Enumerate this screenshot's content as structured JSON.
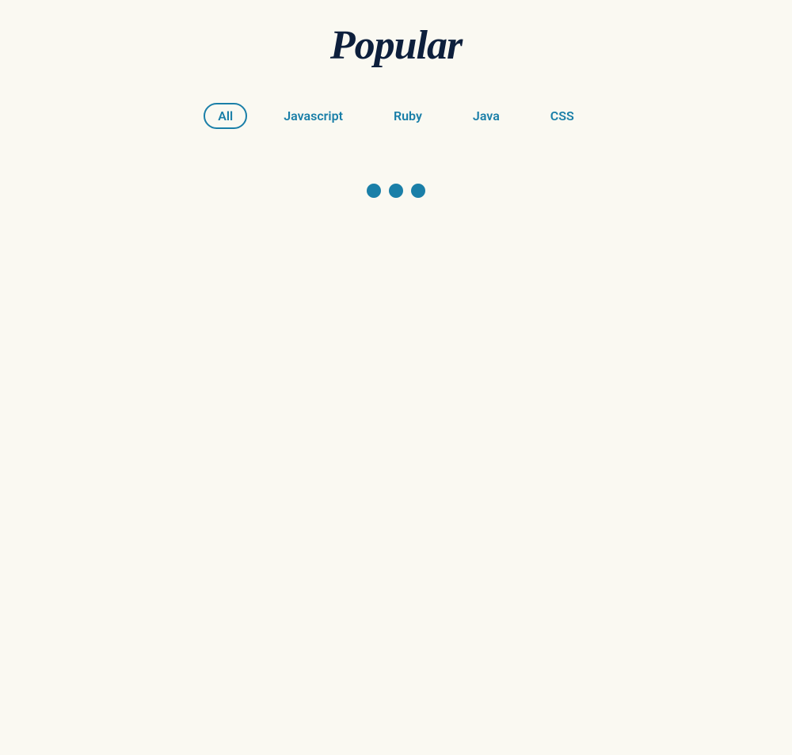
{
  "page": {
    "title": "Popular",
    "background_color": "#faf9f2"
  },
  "filters": {
    "items": [
      {
        "label": "All",
        "active": true
      },
      {
        "label": "Javascript",
        "active": false
      },
      {
        "label": "Ruby",
        "active": false
      },
      {
        "label": "Java",
        "active": false
      },
      {
        "label": "CSS",
        "active": false
      }
    ]
  },
  "loading": {
    "dot_color": "#1a7fa8",
    "dot_count": 3
  }
}
